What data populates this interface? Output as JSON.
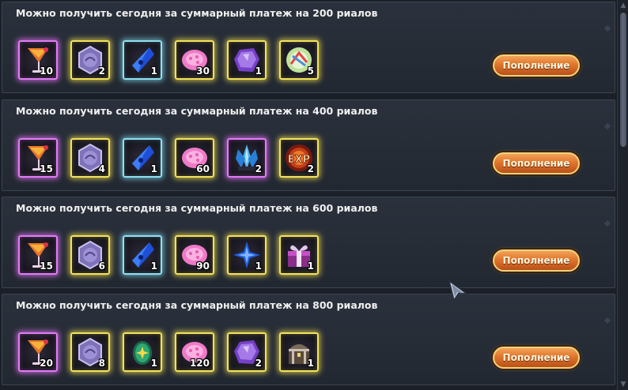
{
  "rows": [
    {
      "title": "Можно получить сегодня за суммарный платеж на 200 риалов",
      "button": "Пополнение",
      "items": [
        {
          "icon": "cocktail-icon",
          "qty": "10"
        },
        {
          "icon": "medallion-icon",
          "qty": "2"
        },
        {
          "icon": "blue-crystal-icon",
          "qty": "1"
        },
        {
          "icon": "pink-gem-icon",
          "qty": "30"
        },
        {
          "icon": "purple-stone-icon",
          "qty": "1"
        },
        {
          "icon": "green-orb-icon",
          "qty": "5"
        }
      ]
    },
    {
      "title": "Можно получить сегодня за суммарный платеж на 400 риалов",
      "button": "Пополнение",
      "items": [
        {
          "icon": "cocktail-icon",
          "qty": "15"
        },
        {
          "icon": "medallion-icon",
          "qty": "4"
        },
        {
          "icon": "blue-crystal-icon",
          "qty": "1"
        },
        {
          "icon": "pink-gem-icon",
          "qty": "60"
        },
        {
          "icon": "ice-crystal-cluster-icon",
          "qty": "2"
        },
        {
          "icon": "exp-orb-icon",
          "qty": "2",
          "label": "EXP"
        }
      ]
    },
    {
      "title": "Можно получить сегодня за суммарный платеж на 600 риалов",
      "button": "Пополнение",
      "items": [
        {
          "icon": "cocktail-icon",
          "qty": "15"
        },
        {
          "icon": "medallion-icon",
          "qty": "6"
        },
        {
          "icon": "blue-crystal-icon",
          "qty": "1"
        },
        {
          "icon": "pink-gem-icon",
          "qty": "90"
        },
        {
          "icon": "blue-star-icon",
          "qty": "1"
        },
        {
          "icon": "gift-box-icon",
          "qty": "1"
        }
      ]
    },
    {
      "title": "Можно получить сегодня за суммарный платеж на 800 риалов",
      "button": "Пополнение",
      "items": [
        {
          "icon": "cocktail-icon",
          "qty": "20"
        },
        {
          "icon": "medallion-icon",
          "qty": "8"
        },
        {
          "icon": "green-egg-icon",
          "qty": "1"
        },
        {
          "icon": "pink-gem-icon",
          "qty": "120"
        },
        {
          "icon": "purple-stone-icon",
          "qty": "2"
        },
        {
          "icon": "treasure-chest-icon",
          "qty": "1"
        }
      ]
    }
  ],
  "colors": {
    "title": "#f0f0f0",
    "button_text": "#fff6de",
    "button_orange": "#e0762c",
    "frame_pink": "#e07cf4",
    "frame_gold": "#f3e25c",
    "frame_blue": "#8fe0f0"
  }
}
